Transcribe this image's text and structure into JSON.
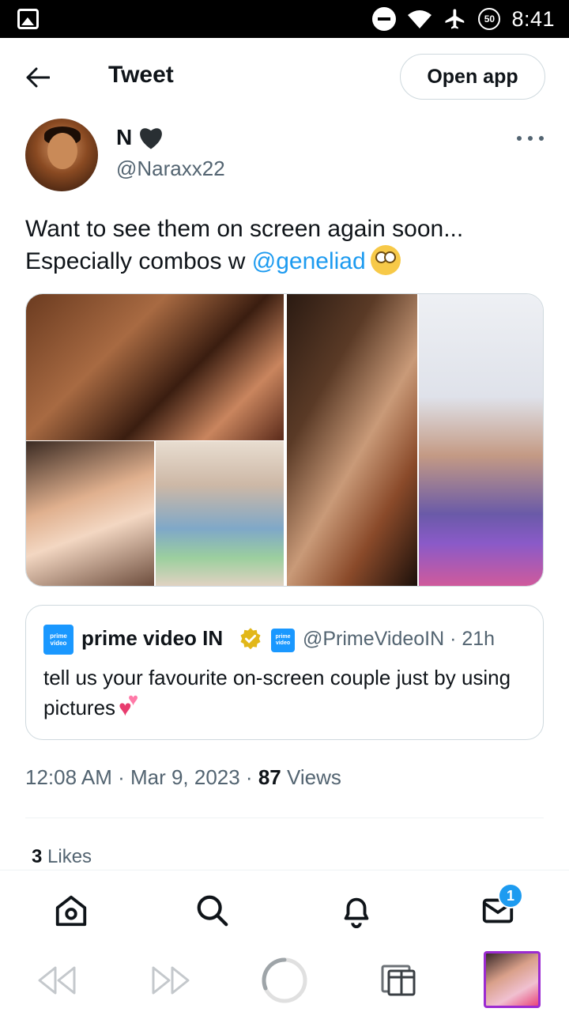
{
  "status_bar": {
    "time": "8:41",
    "battery": "50"
  },
  "header": {
    "title": "Tweet",
    "open_app": "Open app"
  },
  "tweet": {
    "author_name": "N",
    "author_handle": "@Naraxx22",
    "text_line1": "Want to see them on screen again soon...",
    "text_line2_prefix": "Especially combos w ",
    "mention": "@geneliad",
    "timestamp": "12:08 AM · Mar 9, 2023 · ",
    "views_count": "87",
    "views_label": " Views",
    "likes_count": "3",
    "likes_label": " Likes"
  },
  "quote": {
    "avatar_text_1": "prime",
    "avatar_text_2": "video",
    "name": "prime video IN",
    "handle": "@PrimeVideoIN · 21h",
    "text": "tell us your favourite on-screen couple just by using pictures"
  },
  "bottom_nav": {
    "badge": "1"
  }
}
